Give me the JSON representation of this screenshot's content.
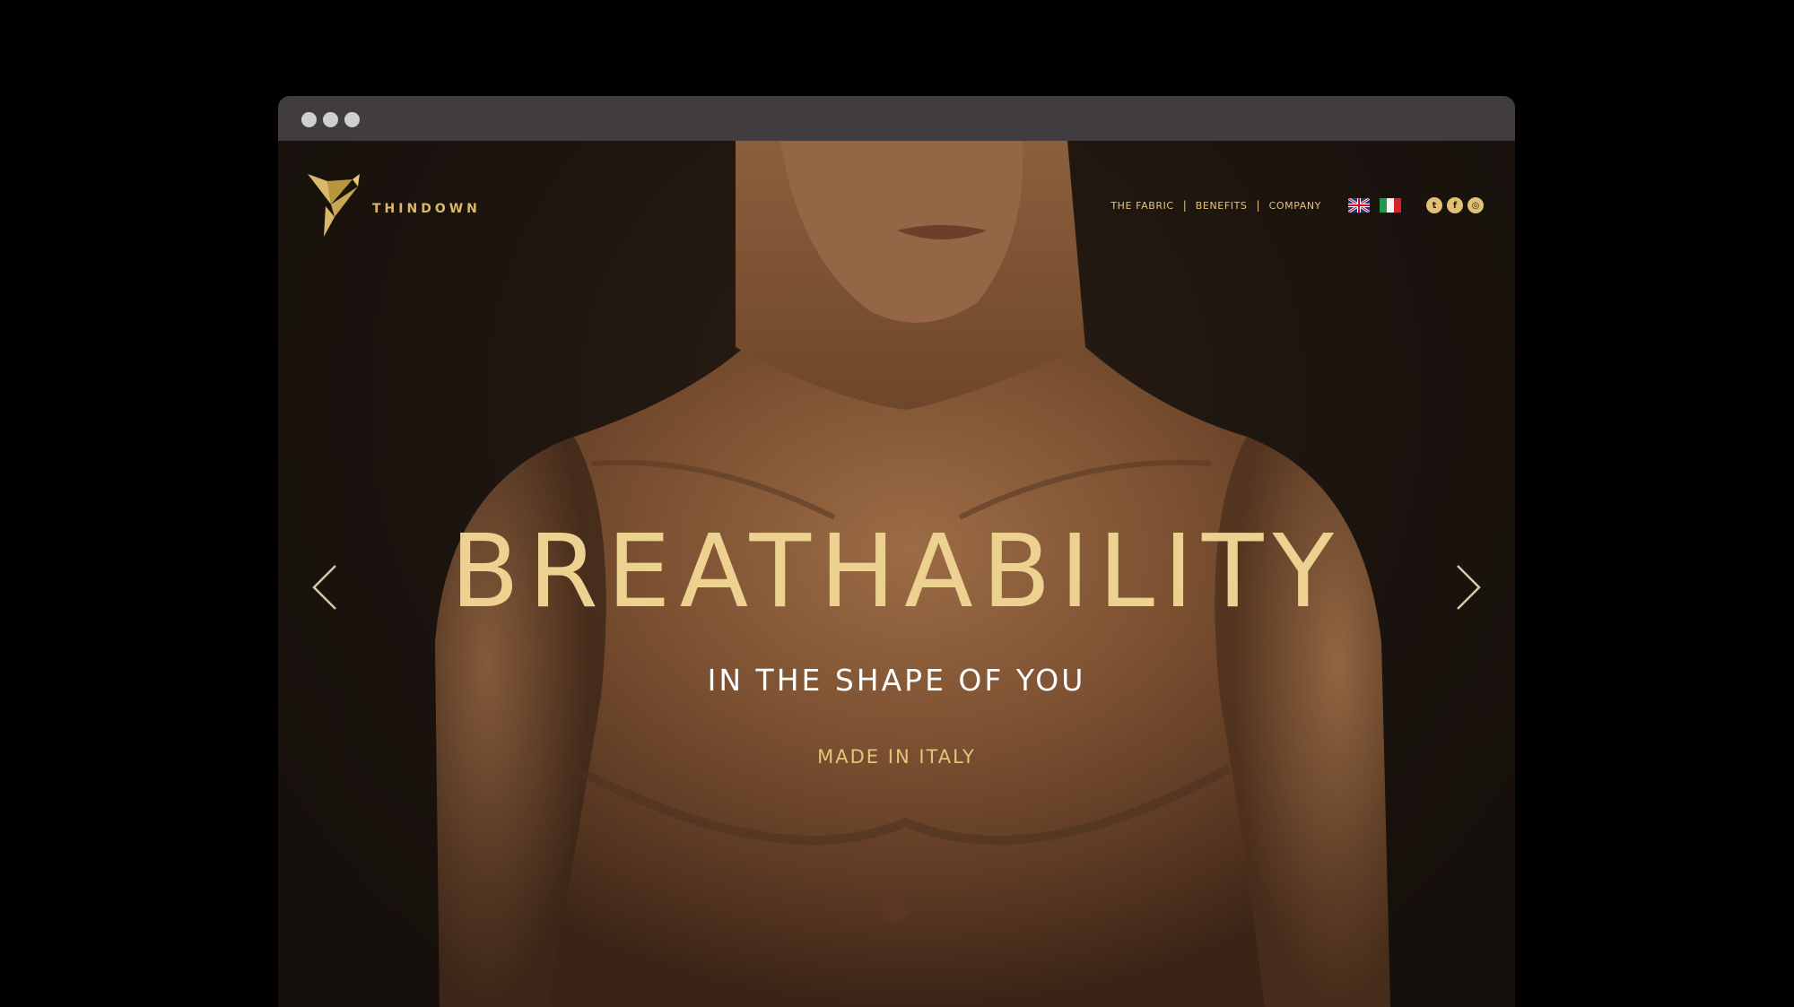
{
  "browser": {
    "window_dots": [
      "dot",
      "dot",
      "dot"
    ]
  },
  "header": {
    "brand": "THINDOWN",
    "nav": [
      {
        "label": "THE FABRIC"
      },
      {
        "label": "BENEFITS"
      },
      {
        "label": "COMPANY"
      }
    ],
    "separator": "|",
    "languages": [
      {
        "name": "uk-flag-icon"
      },
      {
        "name": "italy-flag-icon"
      }
    ],
    "social": [
      {
        "name": "twitter-icon",
        "glyph": "t"
      },
      {
        "name": "facebook-icon",
        "glyph": "f"
      },
      {
        "name": "instagram-icon",
        "glyph": "◎"
      }
    ]
  },
  "hero": {
    "title": "BREATHABILITY",
    "subtitle": "IN THE SHAPE OF YOU",
    "tagline": "MADE IN ITALY"
  },
  "colors": {
    "gold": "#e4c57a",
    "title_gold": "#ecd190",
    "chrome": "#413c40",
    "background": "#000000"
  }
}
